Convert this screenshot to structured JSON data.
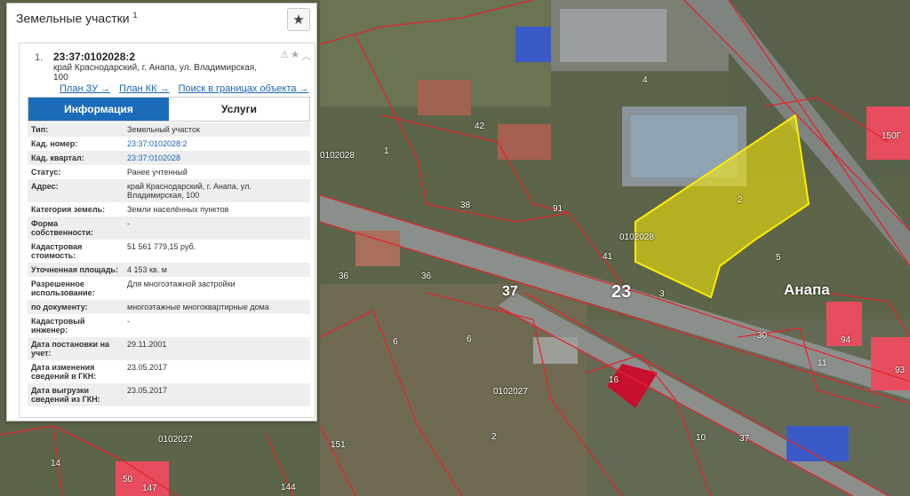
{
  "panel": {
    "title": "Земельные участки",
    "title_sup": "1"
  },
  "card": {
    "number": "1.",
    "cad_number": "23:37:0102028:2",
    "address_line1": "край Краснодарский, г. Анапа, ул. Владимирская,",
    "address_line2": "100",
    "link_plan_zu": "План ЗУ →",
    "link_plan_kk": "План КК →",
    "link_search": "Поиск в границах объекта →"
  },
  "tabs": {
    "info": "Информация",
    "services": "Услуги"
  },
  "props": [
    {
      "k": "Тип:",
      "v": "Земельный участок"
    },
    {
      "k": "Кад. номер:",
      "v": "23:37:0102028:2"
    },
    {
      "k": "Кад. квартал:",
      "v": "23:37:0102028"
    },
    {
      "k": "Статус:",
      "v": "Ранее учтенный"
    },
    {
      "k": "Адрес:",
      "v": "край Краснодарский, г. Анапа, ул. Владимирская, 100"
    },
    {
      "k": "Категория земель:",
      "v": "Земли населённых пунктов"
    },
    {
      "k": "Форма собственности:",
      "v": "-"
    },
    {
      "k": "Кадастровая стоимость:",
      "v": "51 561 779,15 руб."
    },
    {
      "k": "Уточненная площадь:",
      "v": "4 153 кв. м"
    },
    {
      "k": "Разрешенное использование:",
      "v": "Для многоэтажной застройки"
    },
    {
      "k": "по документу:",
      "v": "многоэтажные многоквартирные дома"
    },
    {
      "k": "Кадастровый инженер:",
      "v": "-"
    },
    {
      "k": "Дата постановки на учет:",
      "v": "29.11.2001"
    },
    {
      "k": "Дата изменения сведений в ГКН:",
      "v": "23.05.2017"
    },
    {
      "k": "Дата выгрузки сведений из ГКН:",
      "v": "23.05.2017"
    }
  ],
  "map_labels": {
    "quarter_a": "0102028",
    "quarter_b": "0102028",
    "quarter_c": "0102027",
    "quarter_d": "0102027",
    "road_37": "37",
    "road_23": "23",
    "city": "Анапа",
    "parcel_2": "2",
    "parcel_4": "4",
    "parcel_5": "5",
    "parcel_3": "3",
    "parcel_41": "41",
    "parcel_91": "91",
    "parcel_38": "38",
    "parcel_42": "42",
    "parcel_36": "36",
    "parcel_36b": "36",
    "parcel_6": "6",
    "parcel_6b": "6",
    "parcel_30": "30",
    "parcel_94": "94",
    "parcel_11": "11",
    "parcel_93": "93",
    "parcel_16": "16",
    "parcel_10": "10",
    "parcel_37b": "37",
    "parcel_151": "151",
    "parcel_144": "144",
    "parcel_147": "147",
    "parcel_50": "50",
    "parcel_14": "14",
    "parcel_2b": "2",
    "parcel_1": "1",
    "parcel_150": "150Г"
  },
  "colors": {
    "accent": "#1b6bb8",
    "parcel_line": "#e0262c",
    "highlight": "#ffee00"
  }
}
